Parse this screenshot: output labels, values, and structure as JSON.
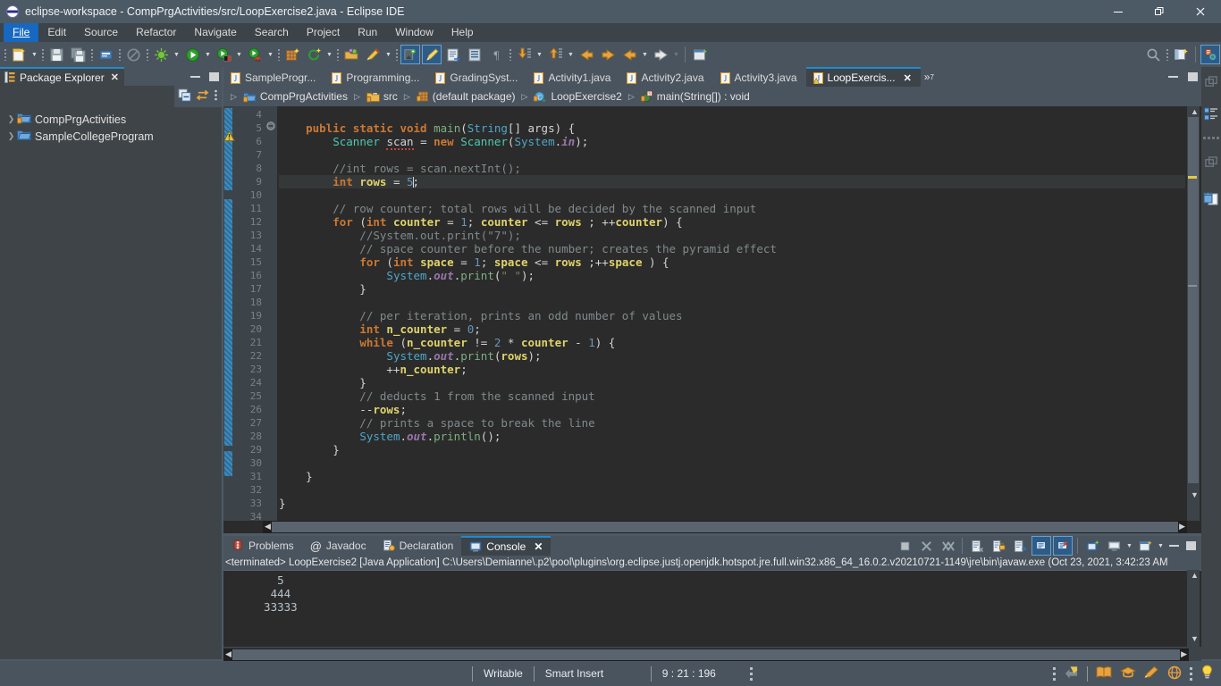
{
  "window": {
    "title": "eclipse-workspace - CompPrgActivities/src/LoopExercise2.java - Eclipse IDE",
    "icon": "eclipse-icon",
    "minimize": "—",
    "maximize": "❐",
    "close": "✕"
  },
  "menubar": {
    "items": [
      {
        "label": "File",
        "mnemonic": "F",
        "active": true
      },
      {
        "label": "Edit",
        "mnemonic": "E",
        "active": false
      },
      {
        "label": "Source",
        "mnemonic": "S",
        "active": false
      },
      {
        "label": "Refactor",
        "mnemonic": "R",
        "active": false
      },
      {
        "label": "Navigate",
        "mnemonic": "N",
        "active": false
      },
      {
        "label": "Search",
        "mnemonic": "a",
        "active": false
      },
      {
        "label": "Project",
        "mnemonic": "P",
        "active": false
      },
      {
        "label": "Run",
        "mnemonic": "R",
        "active": false
      },
      {
        "label": "Window",
        "mnemonic": "W",
        "active": false
      },
      {
        "label": "Help",
        "mnemonic": "H",
        "active": false
      }
    ]
  },
  "toolbar": {
    "icons": [
      "new-wizard-icon",
      "save-icon",
      "save-all-icon",
      "print-icon",
      "no-entry-icon",
      "debug-icon",
      "run-icon",
      "run-configurations-icon",
      "coverage-icon",
      "new-java-package-icon",
      "refresh-icon",
      "open-type-icon",
      "search-icon",
      "next-annotation-icon",
      "previous-annotation-icon",
      "last-edit-location-icon",
      "back-icon",
      "forward-icon",
      "new-window-icon",
      "quick-access-search-icon",
      "open-perspective-icon",
      "java-perspective-icon"
    ]
  },
  "package_explorer": {
    "tab_label": "Package Explorer",
    "tab_close": "✕",
    "toolbar_icons": [
      "collapse-all-icon",
      "link-with-editor-icon",
      "view-menu-icon"
    ],
    "tree": [
      {
        "label": "CompPrgActivities",
        "expanded": false
      },
      {
        "label": "SampleCollegeProgram",
        "expanded": false
      }
    ]
  },
  "editor": {
    "tabs": [
      {
        "label": "SampleProgr...",
        "active": false,
        "closable": false
      },
      {
        "label": "Programming...",
        "active": false,
        "closable": false
      },
      {
        "label": "GradingSyst...",
        "active": false,
        "closable": false
      },
      {
        "label": "Activity1.java",
        "active": false,
        "closable": false
      },
      {
        "label": "Activity2.java",
        "active": false,
        "closable": false
      },
      {
        "label": "Activity3.java",
        "active": false,
        "closable": false
      },
      {
        "label": "LoopExercis...",
        "active": true,
        "closable": true
      }
    ],
    "tab_close": "✕",
    "overflow_label": "»",
    "overflow_count": "7",
    "breadcrumb": [
      {
        "label": "CompPrgActivities",
        "icon": "java-project-icon"
      },
      {
        "label": "src",
        "icon": "source-folder-icon"
      },
      {
        "label": "(default package)",
        "icon": "package-icon"
      },
      {
        "label": "LoopExercise2",
        "icon": "java-class-icon"
      },
      {
        "label": "main(String[]) : void",
        "icon": "method-icon"
      }
    ],
    "breadcrumb_separator": "▷",
    "first_visible_line": 4,
    "last_line": 34,
    "cursor_line": 9,
    "lines": [
      {
        "n": 4,
        "tokens": []
      },
      {
        "n": 5,
        "fold": true,
        "tokens": [
          {
            "t": "    ",
            "c": "var"
          },
          {
            "t": "public ",
            "c": "kw"
          },
          {
            "t": "static ",
            "c": "kw"
          },
          {
            "t": "void ",
            "c": "kw"
          },
          {
            "t": "main",
            "c": "mth"
          },
          {
            "t": "(",
            "c": "var"
          },
          {
            "t": "String",
            "c": "cls"
          },
          {
            "t": "[] args) {",
            "c": "var"
          }
        ]
      },
      {
        "n": 6,
        "tokens": [
          {
            "t": "        ",
            "c": "var"
          },
          {
            "t": "Scanner ",
            "c": "typ"
          },
          {
            "t": "scan",
            "c": "var",
            "err": true
          },
          {
            "t": " = ",
            "c": "var"
          },
          {
            "t": "new ",
            "c": "kw"
          },
          {
            "t": "Scanner",
            "c": "typ"
          },
          {
            "t": "(",
            "c": "var"
          },
          {
            "t": "System",
            "c": "cls"
          },
          {
            "t": ".",
            "c": "var"
          },
          {
            "t": "in",
            "c": "fld"
          },
          {
            "t": ");",
            "c": "var"
          }
        ]
      },
      {
        "n": 7,
        "tokens": []
      },
      {
        "n": 8,
        "tokens": [
          {
            "t": "        //int rows = scan.nextInt();",
            "c": "cmt"
          }
        ]
      },
      {
        "n": 9,
        "cursor": true,
        "tokens": [
          {
            "t": "        ",
            "c": "var"
          },
          {
            "t": "int ",
            "c": "kw"
          },
          {
            "t": "rows",
            "c": "loc"
          },
          {
            "t": " = ",
            "c": "var"
          },
          {
            "t": "5",
            "c": "num"
          },
          {
            "t": "|",
            "c": "caret"
          },
          {
            "t": ";",
            "c": "var"
          }
        ]
      },
      {
        "n": 10,
        "tokens": []
      },
      {
        "n": 11,
        "tokens": [
          {
            "t": "        // row counter; total rows will be decided by the scanned input",
            "c": "cmt"
          }
        ]
      },
      {
        "n": 12,
        "tokens": [
          {
            "t": "        ",
            "c": "var"
          },
          {
            "t": "for ",
            "c": "kw"
          },
          {
            "t": "(",
            "c": "var"
          },
          {
            "t": "int ",
            "c": "kw"
          },
          {
            "t": "counter",
            "c": "loc"
          },
          {
            "t": " = ",
            "c": "var"
          },
          {
            "t": "1",
            "c": "num"
          },
          {
            "t": "; ",
            "c": "var"
          },
          {
            "t": "counter",
            "c": "loc"
          },
          {
            "t": " <= ",
            "c": "var"
          },
          {
            "t": "rows",
            "c": "loc"
          },
          {
            "t": " ; ++",
            "c": "var"
          },
          {
            "t": "counter",
            "c": "loc"
          },
          {
            "t": ") {",
            "c": "var"
          }
        ]
      },
      {
        "n": 13,
        "tokens": [
          {
            "t": "            //System.out.print(\"7\");",
            "c": "cmt"
          }
        ]
      },
      {
        "n": 14,
        "tokens": [
          {
            "t": "            // space counter before the number; creates the pyramid effect",
            "c": "cmt"
          }
        ]
      },
      {
        "n": 15,
        "tokens": [
          {
            "t": "            ",
            "c": "var"
          },
          {
            "t": "for ",
            "c": "kw"
          },
          {
            "t": "(",
            "c": "var"
          },
          {
            "t": "int ",
            "c": "kw"
          },
          {
            "t": "space",
            "c": "loc"
          },
          {
            "t": " = ",
            "c": "var"
          },
          {
            "t": "1",
            "c": "num"
          },
          {
            "t": "; ",
            "c": "var"
          },
          {
            "t": "space",
            "c": "loc"
          },
          {
            "t": " <= ",
            "c": "var"
          },
          {
            "t": "rows",
            "c": "loc"
          },
          {
            "t": " ;++",
            "c": "var"
          },
          {
            "t": "space",
            "c": "loc"
          },
          {
            "t": " ) {",
            "c": "var"
          }
        ]
      },
      {
        "n": 16,
        "tokens": [
          {
            "t": "                ",
            "c": "var"
          },
          {
            "t": "System",
            "c": "cls"
          },
          {
            "t": ".",
            "c": "var"
          },
          {
            "t": "out",
            "c": "fld"
          },
          {
            "t": ".",
            "c": "var"
          },
          {
            "t": "print",
            "c": "mth"
          },
          {
            "t": "(",
            "c": "var"
          },
          {
            "t": "\" \"",
            "c": "str"
          },
          {
            "t": ");",
            "c": "var"
          }
        ]
      },
      {
        "n": 17,
        "tokens": [
          {
            "t": "            }",
            "c": "var"
          }
        ]
      },
      {
        "n": 18,
        "tokens": []
      },
      {
        "n": 19,
        "tokens": [
          {
            "t": "            // per iteration, prints an odd number of values",
            "c": "cmt"
          }
        ]
      },
      {
        "n": 20,
        "tokens": [
          {
            "t": "            ",
            "c": "var"
          },
          {
            "t": "int ",
            "c": "kw"
          },
          {
            "t": "n_counter",
            "c": "loc"
          },
          {
            "t": " = ",
            "c": "var"
          },
          {
            "t": "0",
            "c": "num"
          },
          {
            "t": ";",
            "c": "var"
          }
        ]
      },
      {
        "n": 21,
        "tokens": [
          {
            "t": "            ",
            "c": "var"
          },
          {
            "t": "while ",
            "c": "kw"
          },
          {
            "t": "(",
            "c": "var"
          },
          {
            "t": "n_counter",
            "c": "loc"
          },
          {
            "t": " != ",
            "c": "var"
          },
          {
            "t": "2",
            "c": "num"
          },
          {
            "t": " * ",
            "c": "var"
          },
          {
            "t": "counter",
            "c": "loc"
          },
          {
            "t": " - ",
            "c": "var"
          },
          {
            "t": "1",
            "c": "num"
          },
          {
            "t": ") {",
            "c": "var"
          }
        ]
      },
      {
        "n": 22,
        "tokens": [
          {
            "t": "                ",
            "c": "var"
          },
          {
            "t": "System",
            "c": "cls"
          },
          {
            "t": ".",
            "c": "var"
          },
          {
            "t": "out",
            "c": "fld"
          },
          {
            "t": ".",
            "c": "var"
          },
          {
            "t": "print",
            "c": "mth"
          },
          {
            "t": "(",
            "c": "var"
          },
          {
            "t": "rows",
            "c": "loc"
          },
          {
            "t": ");",
            "c": "var"
          }
        ]
      },
      {
        "n": 23,
        "tokens": [
          {
            "t": "                ++",
            "c": "var"
          },
          {
            "t": "n_counter",
            "c": "loc"
          },
          {
            "t": ";",
            "c": "var"
          }
        ]
      },
      {
        "n": 24,
        "tokens": [
          {
            "t": "            }",
            "c": "var"
          }
        ]
      },
      {
        "n": 25,
        "tokens": [
          {
            "t": "            // deducts 1 from the scanned input",
            "c": "cmt"
          }
        ]
      },
      {
        "n": 26,
        "tokens": [
          {
            "t": "            --",
            "c": "var"
          },
          {
            "t": "rows",
            "c": "loc"
          },
          {
            "t": ";",
            "c": "var"
          }
        ]
      },
      {
        "n": 27,
        "tokens": [
          {
            "t": "            // prints a space to break the line",
            "c": "cmt"
          }
        ]
      },
      {
        "n": 28,
        "tokens": [
          {
            "t": "            ",
            "c": "var"
          },
          {
            "t": "System",
            "c": "cls"
          },
          {
            "t": ".",
            "c": "var"
          },
          {
            "t": "out",
            "c": "fld"
          },
          {
            "t": ".",
            "c": "var"
          },
          {
            "t": "println",
            "c": "mth"
          },
          {
            "t": "();",
            "c": "var"
          }
        ]
      },
      {
        "n": 29,
        "tokens": [
          {
            "t": "        }",
            "c": "var"
          }
        ]
      },
      {
        "n": 30,
        "tokens": []
      },
      {
        "n": 31,
        "tokens": [
          {
            "t": "    }",
            "c": "var"
          }
        ]
      },
      {
        "n": 32,
        "tokens": []
      },
      {
        "n": 33,
        "tokens": [
          {
            "t": "}",
            "c": "var"
          }
        ]
      },
      {
        "n": 34,
        "tokens": []
      }
    ]
  },
  "console_panel": {
    "tabs": [
      {
        "label": "Problems",
        "icon": "problems-icon",
        "active": false,
        "closable": false
      },
      {
        "label": "Javadoc",
        "icon": "javadoc-icon",
        "active": false,
        "closable": false
      },
      {
        "label": "Declaration",
        "icon": "declaration-icon",
        "active": false,
        "closable": false
      },
      {
        "label": "Console",
        "icon": "console-icon",
        "active": true,
        "closable": true
      }
    ],
    "tab_close": "✕",
    "toolbar_icons": [
      "terminate-icon",
      "remove-launch-icon",
      "remove-all-terminated-icon",
      "clear-console-icon",
      "scroll-lock-icon",
      "word-wrap-icon",
      "pin-console-icon",
      "display-selected-console-icon",
      "new-console-view-icon",
      "open-console-icon",
      "minimize-icon",
      "maximize-icon"
    ],
    "header": "<terminated> LoopExercise2 [Java Application] C:\\Users\\Demianne\\.p2\\pool\\plugins\\org.eclipse.justj.openjdk.hotspot.jre.full.win32.x86_64_16.0.2.v20210721-1149\\jre\\bin\\javaw.exe  (Oct 23, 2021, 3:42:23 AM",
    "output": "    5\n   444\n  33333"
  },
  "right_strip": {
    "icons": [
      "restore-icon",
      "outline-view-icon",
      "minimize-group-icon",
      "task-list-icon"
    ]
  },
  "status_bar": {
    "writable": "Writable",
    "insert_mode": "Smart Insert",
    "position": "9 : 21 : 196",
    "right_icons": [
      "undo-history-icon",
      "book-icon",
      "graduation-cap-icon",
      "pencil-icon",
      "globe-icon",
      "tip-icon"
    ]
  },
  "colors": {
    "accent": "#1e8bd1",
    "titlebar": "#4c5a66",
    "menubar": "#3c4349",
    "toolbar": "#4a545e",
    "editor_bg": "#2b2b2b",
    "panel_bg": "#3f4448",
    "keyword": "#cc7832",
    "string": "#6a8759",
    "comment": "#808a8c",
    "number": "#6897bb",
    "class_name": "#4fa6c8",
    "type_name": "#4ec9b0",
    "field": "#9876aa",
    "local_var": "#e0d36a"
  }
}
